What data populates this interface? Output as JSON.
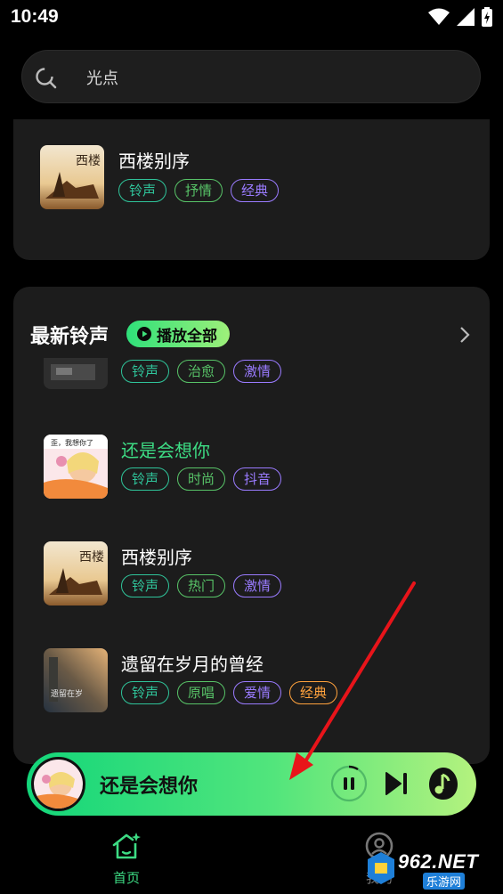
{
  "status_bar": {
    "time": "10:49"
  },
  "search": {
    "placeholder": "光点"
  },
  "top_card": {
    "song": {
      "title": "西楼别序",
      "tags": [
        "铃声",
        "抒情",
        "经典"
      ]
    }
  },
  "latest_section": {
    "title": "最新铃声",
    "play_all_label": "播放全部",
    "songs": [
      {
        "title": "",
        "tags": [
          "铃声",
          "治愈",
          "激情"
        ]
      },
      {
        "title": "还是会想你",
        "tags": [
          "铃声",
          "时尚",
          "抖音"
        ],
        "active": true,
        "cover_text": "歪，我想你了"
      },
      {
        "title": "西楼别序",
        "tags": [
          "铃声",
          "热门",
          "激情"
        ]
      },
      {
        "title": "遗留在岁月的曾经",
        "tags": [
          "铃声",
          "原唱",
          "爱情",
          "经典"
        ]
      }
    ]
  },
  "player": {
    "title": "还是会想你",
    "state": "playing"
  },
  "bottom_nav": {
    "home_label": "首页",
    "mine_label": "我的"
  },
  "watermark": {
    "text": "962.NET",
    "sub": "乐游网"
  },
  "colors": {
    "accent": "#3ddc84",
    "tag_teal": "#2fc49a",
    "tag_green": "#58c468",
    "tag_purple": "#9a7bff",
    "tag_orange": "#ffa23d",
    "arrow": "#e8141a"
  }
}
